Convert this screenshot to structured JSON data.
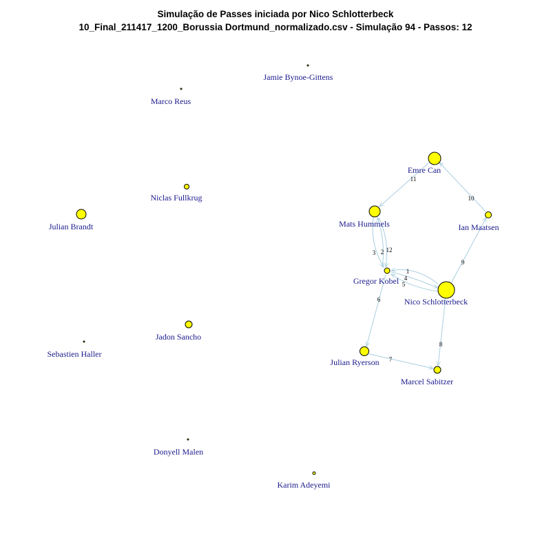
{
  "title": {
    "line1": "Simulação de Passes iniciada por Nico Schlotterbeck",
    "line2": "10_Final_211417_1200_Borussia Dortmund_normalizado.csv - Simulação 94 - Passos: 12"
  },
  "colors": {
    "node_fill": "#ffff00",
    "node_stroke": "#000000",
    "edge": "#a9cfe0",
    "label": "#1a1a8c"
  },
  "nodes": [
    {
      "id": "jamie",
      "label": "Jamie Bynoe-Gittens"
    },
    {
      "id": "reus",
      "label": "Marco Reus"
    },
    {
      "id": "can",
      "label": "Emre Can"
    },
    {
      "id": "fullkrug",
      "label": "Niclas Fullkrug"
    },
    {
      "id": "brandt",
      "label": "Julian Brandt"
    },
    {
      "id": "hummels",
      "label": "Mats Hummels"
    },
    {
      "id": "maatsen",
      "label": "Ian Maatsen"
    },
    {
      "id": "kobel",
      "label": "Gregor Kobel"
    },
    {
      "id": "schlotterbeck",
      "label": "Nico Schlotterbeck"
    },
    {
      "id": "sancho",
      "label": "Jadon Sancho"
    },
    {
      "id": "haller",
      "label": "Sebastien Haller"
    },
    {
      "id": "ryerson",
      "label": "Julian Ryerson"
    },
    {
      "id": "sabitzer",
      "label": "Marcel Sabitzer"
    },
    {
      "id": "malen",
      "label": "Donyell Malen"
    },
    {
      "id": "adeyemi",
      "label": "Karim Adeyemi"
    }
  ],
  "edges": [
    {
      "step": "1",
      "from": "schlotterbeck",
      "to": "kobel"
    },
    {
      "step": "2",
      "from": "kobel",
      "to": "hummels"
    },
    {
      "step": "3",
      "from": "hummels",
      "to": "kobel"
    },
    {
      "step": "4",
      "from": "kobel",
      "to": "schlotterbeck"
    },
    {
      "step": "5",
      "from": "schlotterbeck",
      "to": "kobel"
    },
    {
      "step": "6",
      "from": "kobel",
      "to": "ryerson"
    },
    {
      "step": "7",
      "from": "ryerson",
      "to": "sabitzer"
    },
    {
      "step": "8",
      "from": "sabitzer",
      "to": "schlotterbeck"
    },
    {
      "step": "9",
      "from": "schlotterbeck",
      "to": "maatsen"
    },
    {
      "step": "10",
      "from": "maatsen",
      "to": "can"
    },
    {
      "step": "11",
      "from": "can",
      "to": "hummels"
    },
    {
      "step": "12",
      "from": "hummels",
      "to": "kobel"
    }
  ]
}
